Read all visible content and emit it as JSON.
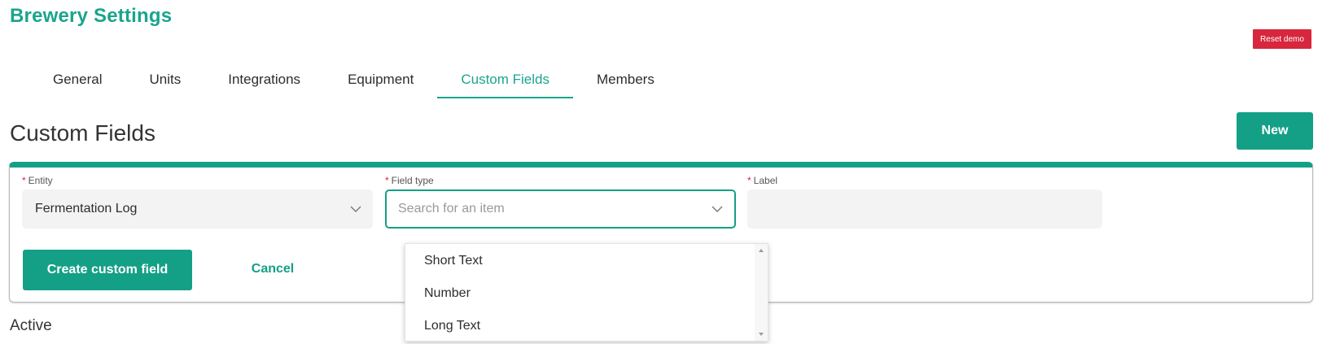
{
  "app": {
    "title": "Brewery Settings",
    "reset_label": "Reset demo"
  },
  "tabs": [
    {
      "label": "General",
      "active": false
    },
    {
      "label": "Units",
      "active": false
    },
    {
      "label": "Integrations",
      "active": false
    },
    {
      "label": "Equipment",
      "active": false
    },
    {
      "label": "Custom Fields",
      "active": true
    },
    {
      "label": "Members",
      "active": false
    }
  ],
  "page": {
    "section_title": "Custom Fields",
    "new_label": "New",
    "active_heading": "Active"
  },
  "form": {
    "required_marker": "*",
    "entity": {
      "label": "Entity",
      "value": "Fermentation Log",
      "icon": "chevron-down-icon"
    },
    "field_type": {
      "label": "Field type",
      "placeholder": "Search for an item",
      "value": "",
      "icon": "chevron-down-icon"
    },
    "label_field": {
      "label": "Label",
      "value": ""
    },
    "create_label": "Create custom field",
    "cancel_label": "Cancel"
  },
  "dropdown": {
    "options": [
      "Short Text",
      "Number",
      "Long Text"
    ]
  },
  "colors": {
    "accent": "#14a086",
    "title": "#1aa58c",
    "danger": "#d7263d"
  }
}
